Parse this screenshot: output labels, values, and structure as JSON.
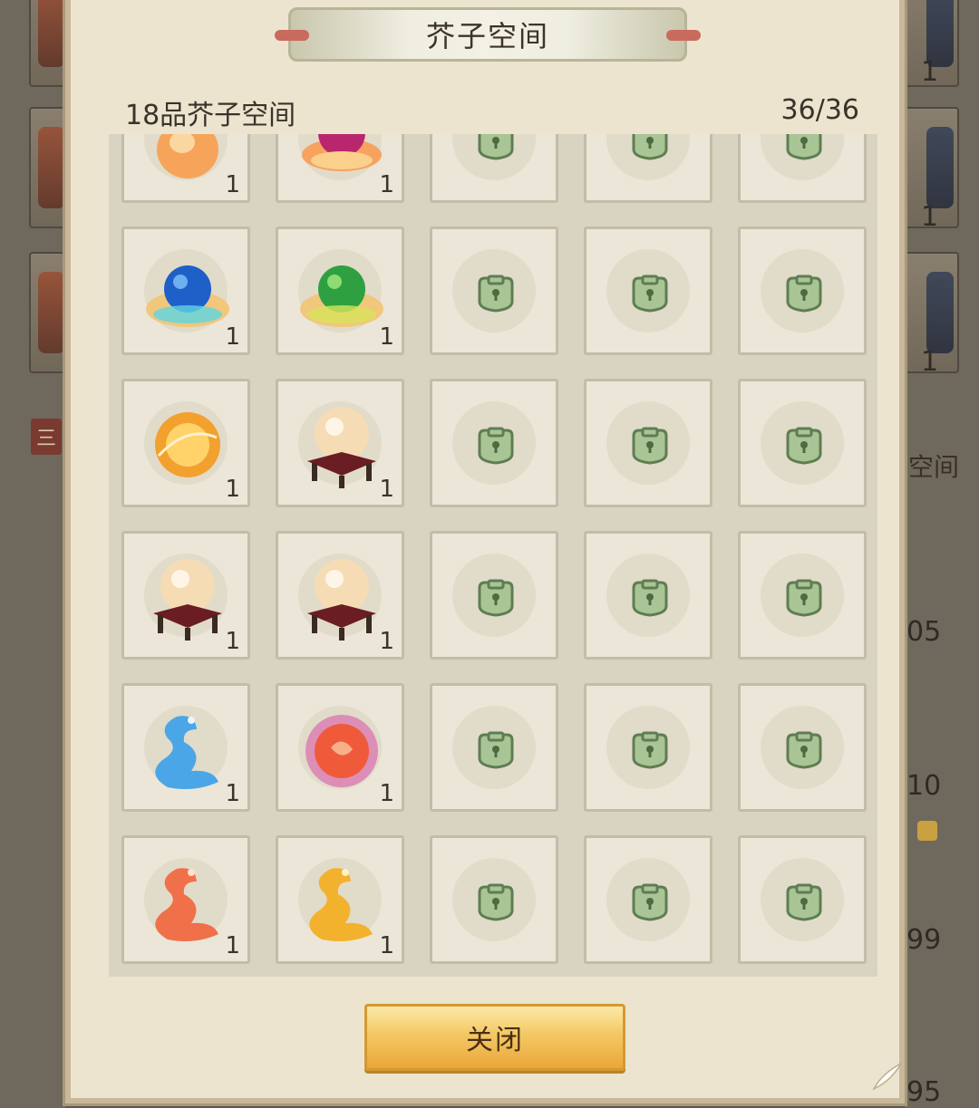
{
  "dialog": {
    "title": "芥子空间",
    "quality_label": "18品芥子空间",
    "capacity": "36/36",
    "close_label": "关闭"
  },
  "background": {
    "right_counts": [
      "1",
      "1",
      "1"
    ],
    "side_label": "空间",
    "left_banner": "三",
    "right_numbers": [
      "05",
      "10",
      "99",
      "95"
    ]
  },
  "slots": [
    {
      "item": "peach-gourd",
      "qty": "1"
    },
    {
      "item": "red-lotus-orb",
      "qty": "1"
    },
    {
      "item": "locked",
      "qty": ""
    },
    {
      "item": "locked",
      "qty": ""
    },
    {
      "item": "locked",
      "qty": ""
    },
    {
      "item": "blue-lotus-orb",
      "qty": "1"
    },
    {
      "item": "green-lotus-orb",
      "qty": "1"
    },
    {
      "item": "locked",
      "qty": ""
    },
    {
      "item": "locked",
      "qty": ""
    },
    {
      "item": "locked",
      "qty": ""
    },
    {
      "item": "amber-spirit-orb",
      "qty": "1"
    },
    {
      "item": "pearl-on-stand",
      "qty": "1"
    },
    {
      "item": "locked",
      "qty": ""
    },
    {
      "item": "locked",
      "qty": ""
    },
    {
      "item": "locked",
      "qty": ""
    },
    {
      "item": "pearl-on-stand",
      "qty": "1"
    },
    {
      "item": "pearl-on-stand",
      "qty": "1"
    },
    {
      "item": "locked",
      "qty": ""
    },
    {
      "item": "locked",
      "qty": ""
    },
    {
      "item": "locked",
      "qty": ""
    },
    {
      "item": "blue-dragon-cloud",
      "qty": "1"
    },
    {
      "item": "rose-flame-orb",
      "qty": "1"
    },
    {
      "item": "locked",
      "qty": ""
    },
    {
      "item": "locked",
      "qty": ""
    },
    {
      "item": "locked",
      "qty": ""
    },
    {
      "item": "red-dragon-cloud",
      "qty": "1"
    },
    {
      "item": "gold-dragon-cloud",
      "qty": "1"
    },
    {
      "item": "locked",
      "qty": ""
    },
    {
      "item": "locked",
      "qty": ""
    },
    {
      "item": "locked",
      "qty": ""
    }
  ]
}
